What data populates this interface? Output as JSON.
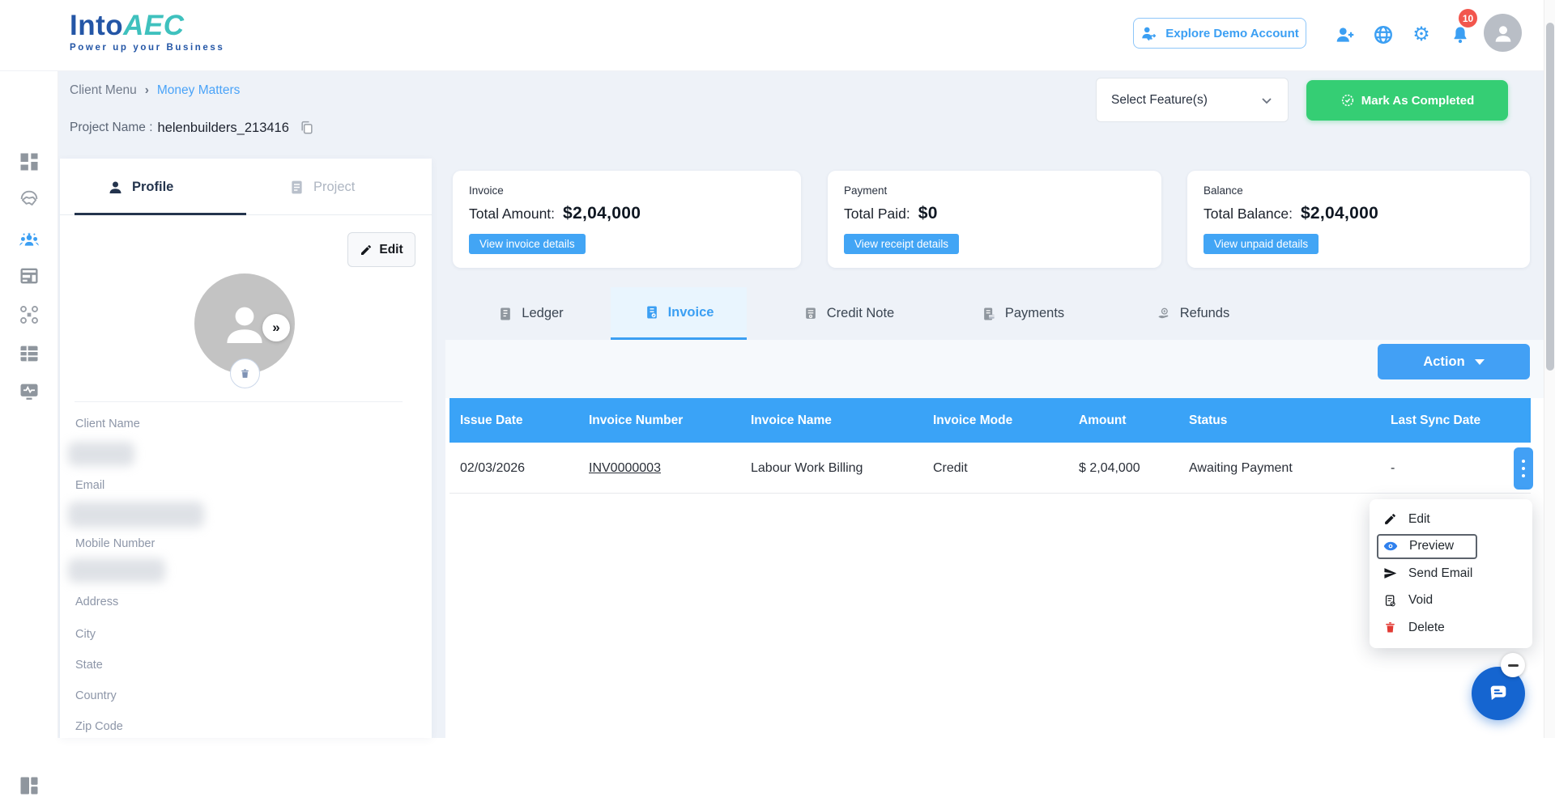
{
  "colors": {
    "accent_blue": "#3b9ff3",
    "table_header_blue": "#3aa3f7",
    "green": "#35ce74",
    "navy": "#24344d",
    "link_blue": "#4a9df5",
    "status_blue": "#4aa3f8",
    "danger_red": "#e23b34",
    "chat_blue": "#1565d0"
  },
  "brand": {
    "title_part1": "Into",
    "title_part2": "AEC",
    "tagline": "Power up your Business"
  },
  "header": {
    "explore_button": "Explore Demo Account",
    "notification_count": "10"
  },
  "sidebar": {
    "items": [
      {
        "name": "dashboard"
      },
      {
        "name": "partners"
      },
      {
        "name": "clients",
        "active": true
      },
      {
        "name": "projects-window"
      },
      {
        "name": "integrations"
      },
      {
        "name": "reports"
      },
      {
        "name": "activity-monitor"
      }
    ],
    "bottom_item": {
      "name": "layout-toggle"
    }
  },
  "breadcrumb": {
    "parent": "Client Menu",
    "separator": "›",
    "current": "Money Matters"
  },
  "project": {
    "label": "Project Name :",
    "value": "helenbuilders_213416"
  },
  "toolbar": {
    "select_features": "Select Feature(s)",
    "mark_completed": "Mark As Completed"
  },
  "client_panel": {
    "tabs": {
      "profile": "Profile",
      "project": "Project"
    },
    "edit_button": "Edit",
    "expand_glyph": "»",
    "fields": [
      {
        "label": "Client Name",
        "redacted": true
      },
      {
        "label": "Email",
        "redacted": true
      },
      {
        "label": "Mobile Number",
        "redacted": true
      },
      {
        "label": "Address",
        "redacted": false
      },
      {
        "label": "City",
        "redacted": false
      },
      {
        "label": "State",
        "redacted": false
      },
      {
        "label": "Country",
        "redacted": false
      },
      {
        "label": "Zip Code",
        "redacted": false
      }
    ]
  },
  "summary_cards": [
    {
      "title": "Invoice",
      "label": "Total Amount:",
      "amount": "$2,04,000",
      "button": "View invoice details"
    },
    {
      "title": "Payment",
      "label": "Total Paid:",
      "amount": "$0",
      "button": "View receipt details"
    },
    {
      "title": "Balance",
      "label": "Total Balance:",
      "amount": "$2,04,000",
      "button": "View unpaid details"
    }
  ],
  "finance_tabs": [
    {
      "label": "Ledger"
    },
    {
      "label": "Invoice",
      "active": true
    },
    {
      "label": "Credit Note"
    },
    {
      "label": "Payments"
    },
    {
      "label": "Refunds"
    }
  ],
  "actions": {
    "action_button": "Action"
  },
  "invoice_table": {
    "columns": [
      "Issue Date",
      "Invoice Number",
      "Invoice Name",
      "Invoice Mode",
      "Amount",
      "Status",
      "Last Sync Date"
    ],
    "rows": [
      {
        "issue_date": "02/03/2026",
        "invoice_number": "INV0000003",
        "invoice_name": "Labour Work Billing",
        "invoice_mode": "Credit",
        "amount": "$ 2,04,000",
        "status": "Awaiting Payment",
        "last_sync_date": "-"
      }
    ]
  },
  "context_menu": {
    "items": [
      {
        "label": "Edit",
        "icon": "pencil-icon"
      },
      {
        "label": "Preview",
        "icon": "eye-icon",
        "focused": true
      },
      {
        "label": "Send Email",
        "icon": "send-icon"
      },
      {
        "label": "Void",
        "icon": "void-icon"
      },
      {
        "label": "Delete",
        "icon": "trash-icon",
        "danger": true
      }
    ]
  }
}
